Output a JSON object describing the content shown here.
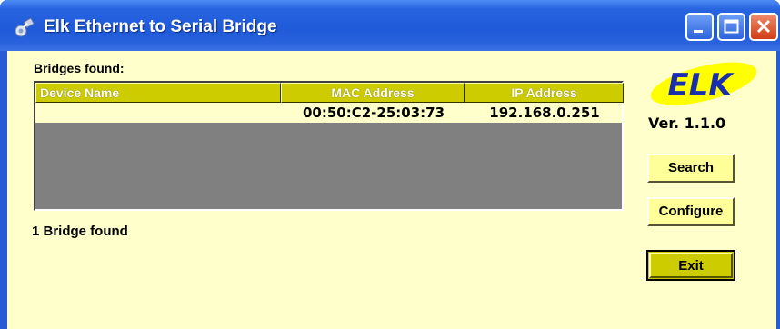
{
  "window": {
    "title": "Elk Ethernet to Serial Bridge"
  },
  "main": {
    "bridges_label": "Bridges found:",
    "status": "1 Bridge found",
    "columns": [
      "Device Name",
      "MAC Address",
      "IP Address"
    ],
    "rows": [
      {
        "device_name": "",
        "mac": "00:50:C2-25:03:73",
        "ip": "192.168.0.251"
      }
    ]
  },
  "side": {
    "logo_text": "ELK",
    "version": "Ver. 1.1.0",
    "search_label": "Search",
    "configure_label": "Configure",
    "exit_label": "Exit"
  },
  "colors": {
    "titlebar": "#2764e0",
    "client_bg": "#ffffcc",
    "header_bg": "#cccc00",
    "logo_yellow": "#ffff00",
    "logo_blue": "#1a2fb0",
    "listview_bg": "#808080"
  }
}
